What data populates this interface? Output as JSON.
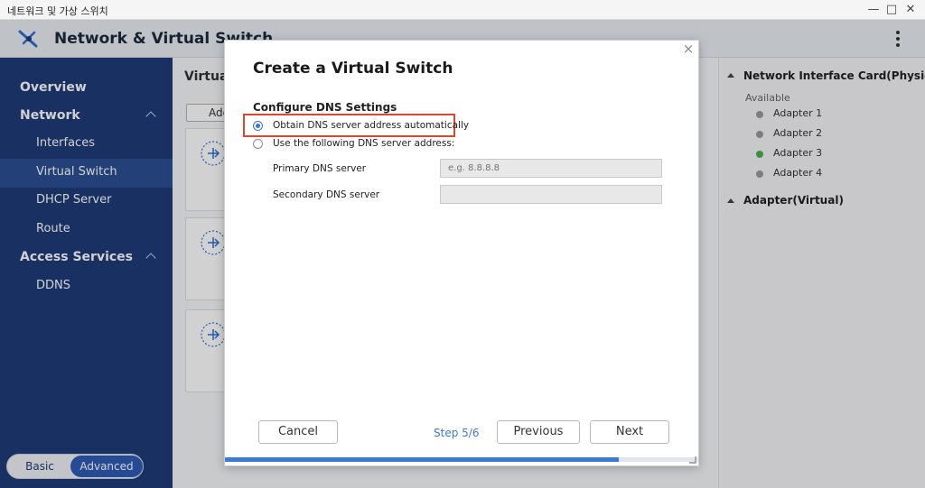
{
  "window": {
    "title": "네트워크 및 가상 스위치"
  },
  "app": {
    "title": "Network & Virtual Switch",
    "title_visible": "Network & Virtual Switch"
  },
  "sidebar": {
    "items": [
      {
        "label": "Overview"
      },
      {
        "label": "Network"
      },
      {
        "label": "Interfaces"
      },
      {
        "label": "Virtual Switch"
      },
      {
        "label": "DHCP Server"
      },
      {
        "label": "Route"
      },
      {
        "label": "Access Services"
      },
      {
        "label": "DDNS"
      }
    ],
    "mode": {
      "basic": "Basic",
      "advanced": "Advanced"
    }
  },
  "main": {
    "title": "Virtual",
    "add_label": "Add"
  },
  "right_panel": {
    "nic_heading": "Network Interface Card(Physical)",
    "available_label": "Available",
    "adapters": [
      {
        "label": "Adapter 1",
        "status": "gray"
      },
      {
        "label": "Adapter 2",
        "status": "gray"
      },
      {
        "label": "Adapter 3",
        "status": "green"
      },
      {
        "label": "Adapter 4",
        "status": "gray"
      }
    ],
    "virtual_heading": "Adapter(Virtual)"
  },
  "dialog": {
    "title": "Create a Virtual Switch",
    "section_title": "Configure DNS Settings",
    "option_auto": "Obtain DNS server address automatically",
    "option_manual": "Use the following DNS server address:",
    "primary_label": "Primary DNS server",
    "primary_placeholder": "e.g. 8.8.8.8",
    "secondary_label": "Secondary DNS server",
    "cancel_label": "Cancel",
    "step_label": "Step 5/6",
    "previous_label": "Previous",
    "next_label": "Next",
    "close_glyph": "×",
    "progress_fraction": 0.833
  },
  "colors": {
    "accent": "#3a7bd5",
    "sidebar": "#1f3b78",
    "highlight": "#e0452e",
    "online": "#4caf50"
  }
}
